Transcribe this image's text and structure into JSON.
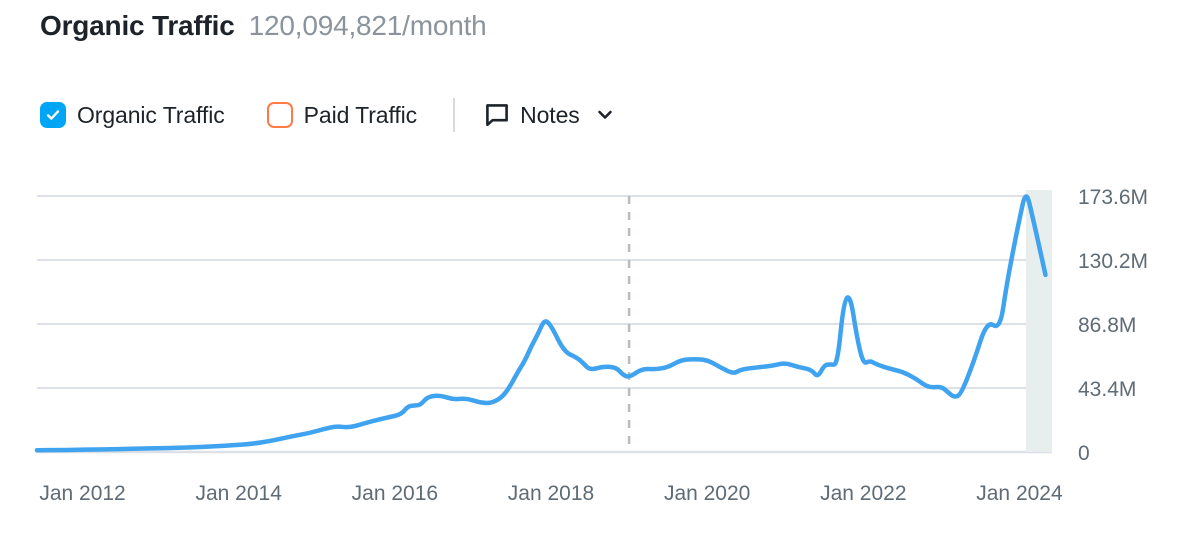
{
  "header": {
    "title": "Organic Traffic",
    "value": "120,094,821/month"
  },
  "legend": {
    "items": [
      {
        "label": "Organic Traffic",
        "checked": true,
        "color": "#00a6f5",
        "icon": "checkbox-checked-icon"
      },
      {
        "label": "Paid Traffic",
        "checked": false,
        "color": "#ff7a45",
        "icon": "checkbox-unchecked-icon"
      }
    ],
    "notes": {
      "label": "Notes",
      "icon": "comment-bubble-icon",
      "chevron": "chevron-down-icon"
    }
  },
  "chart_data": {
    "type": "line",
    "title": "Organic Traffic",
    "xlabel": "",
    "ylabel": "",
    "grid": true,
    "legend_position": "top-left",
    "line_color": "#3fa3ef",
    "ylim": [
      0,
      173600000
    ],
    "y_ticks": [
      0,
      43400000,
      86800000,
      130200000,
      173600000
    ],
    "y_tick_labels": [
      "0",
      "43.4M",
      "86.8M",
      "130.2M",
      "173.6M"
    ],
    "x_tick_labels": [
      "Jan 2012",
      "Jan 2014",
      "Jan 2016",
      "Jan 2018",
      "Jan 2020",
      "Jan 2022",
      "Jan 2024"
    ],
    "x_range": [
      "2011-06",
      "2024-06"
    ],
    "annotations": [
      {
        "type": "vertical-dashed-line",
        "x": "2019-01",
        "color": "#b7bcc4"
      },
      {
        "type": "shaded-band",
        "x_start": "2024-02",
        "x_end": "2024-06",
        "color": "#e8edee"
      }
    ],
    "series": [
      {
        "name": "Organic Traffic",
        "color": "#3fa3ef",
        "x": [
          "2011-06",
          "2011-09",
          "2011-12",
          "2012-03",
          "2012-06",
          "2012-09",
          "2012-12",
          "2013-03",
          "2013-06",
          "2013-09",
          "2013-12",
          "2014-03",
          "2014-06",
          "2014-09",
          "2014-12",
          "2015-02",
          "2015-04",
          "2015-06",
          "2015-08",
          "2015-10",
          "2015-12",
          "2016-02",
          "2016-03",
          "2016-04",
          "2016-05",
          "2016-06",
          "2016-08",
          "2016-10",
          "2016-12",
          "2017-02",
          "2017-04",
          "2017-06",
          "2017-08",
          "2017-09",
          "2017-10",
          "2017-11",
          "2017-12",
          "2018-01",
          "2018-03",
          "2018-05",
          "2018-06",
          "2018-07",
          "2018-09",
          "2018-11",
          "2018-12",
          "2019-01",
          "2019-03",
          "2019-05",
          "2019-07",
          "2019-09",
          "2019-11",
          "2020-01",
          "2020-03",
          "2020-05",
          "2020-06",
          "2020-07",
          "2020-09",
          "2020-11",
          "2021-01",
          "2021-03",
          "2021-05",
          "2021-06",
          "2021-07",
          "2021-08",
          "2021-09",
          "2021-10",
          "2021-11",
          "2021-12",
          "2022-01",
          "2022-02",
          "2022-03",
          "2022-05",
          "2022-07",
          "2022-09",
          "2022-11",
          "2023-01",
          "2023-02",
          "2023-03",
          "2023-04",
          "2023-06",
          "2023-08",
          "2023-10",
          "2023-11",
          "2023-12",
          "2024-01",
          "2024-02",
          "2024-03",
          "2024-05"
        ],
        "values": [
          1200000,
          1300000,
          1500000,
          1700000,
          1900000,
          2200000,
          2500000,
          2800000,
          3200000,
          3800000,
          4500000,
          5500000,
          7500000,
          10500000,
          13000000,
          15500000,
          17500000,
          16500000,
          19000000,
          21500000,
          23500000,
          25500000,
          31000000,
          31500000,
          32000000,
          37500000,
          38500000,
          35500000,
          36500000,
          33500000,
          33000000,
          39000000,
          55000000,
          62000000,
          72000000,
          80000000,
          90000000,
          86000000,
          68000000,
          64000000,
          60000000,
          55500000,
          58000000,
          57500000,
          52500000,
          50500000,
          56500000,
          56000000,
          57500000,
          62500000,
          63000000,
          62500000,
          57500000,
          53000000,
          55500000,
          56500000,
          57500000,
          58500000,
          60500000,
          57500000,
          56000000,
          50500000,
          59000000,
          59500000,
          59000000,
          102500000,
          106500000,
          78000000,
          59500000,
          62000000,
          59500000,
          56500000,
          54500000,
          50000000,
          43500000,
          44500000,
          40500000,
          37000000,
          39000000,
          61500000,
          89000000,
          83000000,
          112500000,
          136000000,
          158000000,
          178000000,
          160000000,
          120094821
        ]
      }
    ]
  }
}
